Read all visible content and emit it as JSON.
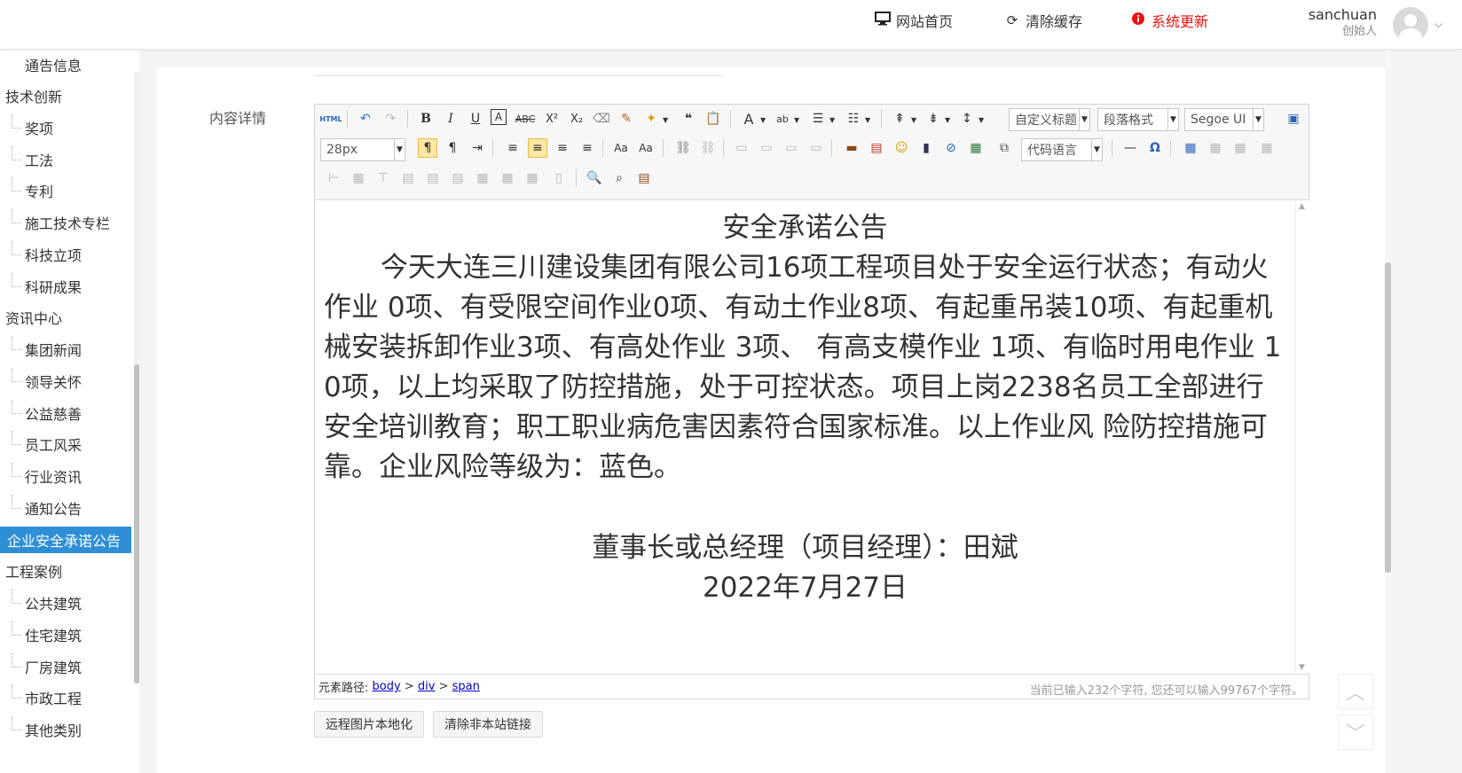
{
  "header": {
    "home_link": "网站首页",
    "clear_cache": "清除缓存",
    "system_update": "系统更新",
    "user_name": "sanchuan",
    "user_role": "创始人"
  },
  "sidebar": {
    "cut_item": "通告信息",
    "items": [
      {
        "label": "技术创新",
        "type": "cat"
      },
      {
        "label": "奖项",
        "type": "sub"
      },
      {
        "label": "工法",
        "type": "sub"
      },
      {
        "label": "专利",
        "type": "sub"
      },
      {
        "label": "施工技术专栏",
        "type": "sub"
      },
      {
        "label": "科技立项",
        "type": "sub"
      },
      {
        "label": "科研成果",
        "type": "sub"
      },
      {
        "label": "资讯中心",
        "type": "cat"
      },
      {
        "label": "集团新闻",
        "type": "sub"
      },
      {
        "label": "领导关怀",
        "type": "sub"
      },
      {
        "label": "公益慈善",
        "type": "sub"
      },
      {
        "label": "员工风采",
        "type": "sub"
      },
      {
        "label": "行业资讯",
        "type": "sub"
      },
      {
        "label": "通知公告",
        "type": "sub"
      },
      {
        "label": "企业安全承诺公告",
        "type": "active"
      },
      {
        "label": "工程案例",
        "type": "cat"
      },
      {
        "label": "公共建筑",
        "type": "sub"
      },
      {
        "label": "住宅建筑",
        "type": "sub"
      },
      {
        "label": "厂房建筑",
        "type": "sub"
      },
      {
        "label": "市政工程",
        "type": "sub"
      },
      {
        "label": "其他类别",
        "type": "sub"
      }
    ]
  },
  "form": {
    "content_label": "内容详情"
  },
  "toolbar": {
    "html": "HTML",
    "custom_title": "自定义标题",
    "paragraph_format": "段落格式",
    "font_family": "Segoe UI",
    "font_size": "28px",
    "code_language": "代码语言"
  },
  "document": {
    "title": "安全承诺公告",
    "body": "今天大连三川建设集团有限公司16项工程项目处于安全运行状态；有动火作业 0项、有受限空间作业0项、有动土作业8项、有起重吊装10项、有起重机械安装拆卸作业3项、有高处作业 3项、 有高支模作业 1项、有临时用电作业 10项，以上均采取了防控措施，处于可控状态。项目上岗2238名员工全部进行安全培训教育；职工职业病危害因素符合国家标准。以上作业风 险防控措施可靠。企业风险等级为：蓝色。",
    "signature": "董事长或总经理（项目经理）：田斌",
    "date": "2022年7月27日"
  },
  "statusbar": {
    "path_label": "元素路径:",
    "path_body": "body",
    "path_div": "div",
    "path_span": "span",
    "sep": ">",
    "count": "当前已输入232个字符, 您还可以输入99767个字符。"
  },
  "buttons": {
    "localize_images": "远程图片本地化",
    "clear_links": "清除非本站链接"
  }
}
